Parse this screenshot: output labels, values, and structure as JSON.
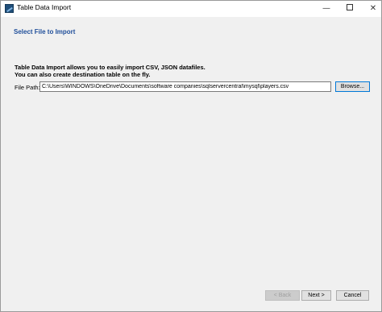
{
  "window": {
    "title": "Table Data Import",
    "minimize_glyph": "—",
    "close_glyph": "✕"
  },
  "page": {
    "section_title": "Select File to Import",
    "description_line1": "Table Data Import allows you to easily import CSV, JSON datafiles.",
    "description_line2": "You can also create destination table on the fly."
  },
  "file": {
    "label": "File Path:",
    "value": "C:\\Users\\WINDOWS\\OneDrive\\Documents\\software companies\\sqlservercentral\\mysql\\players.csv",
    "browse_label": "Browse..."
  },
  "footer": {
    "back_label": "< Back",
    "next_label": "Next >",
    "cancel_label": "Cancel"
  },
  "colors": {
    "accent": "#1f4e9a",
    "focus_border": "#0078d7"
  }
}
